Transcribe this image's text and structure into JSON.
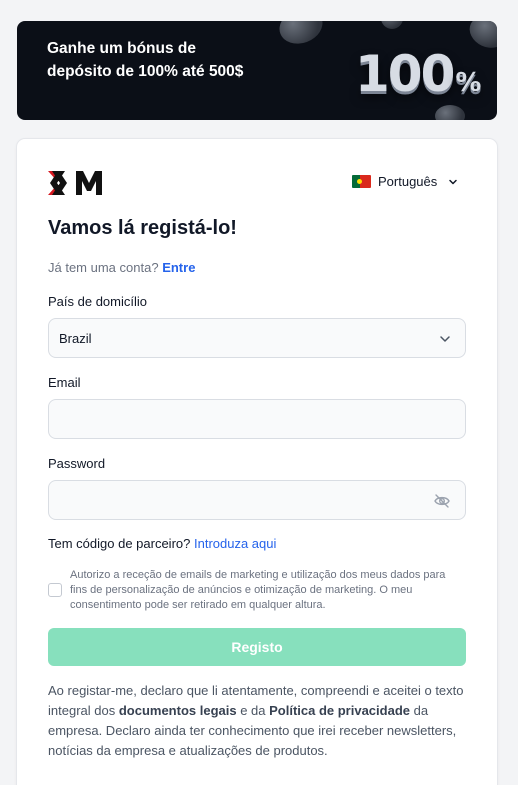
{
  "banner": {
    "text": "Ganhe um bónus de depósito de 100% até 500$",
    "graphic_number": "100",
    "graphic_percent": "%"
  },
  "header": {
    "logo_text": "XM",
    "language": "Português"
  },
  "form": {
    "title": "Vamos lá registá-lo!",
    "have_account_text": "Já tem uma conta?",
    "login_link": "Entre",
    "country_label": "País de domicílio",
    "country_value": "Brazil",
    "email_label": "Email",
    "email_value": "",
    "password_label": "Password",
    "password_value": "",
    "partner_text": "Tem código de parceiro?",
    "partner_link": "Introduza aqui",
    "consent_text": "Autorizo a receção de emails de marketing e utilização dos meus dados para fins de personalização de anúncios e otimização de marketing. O meu consentimento pode ser retirado em qualquer altura.",
    "consent_checked": false,
    "submit_label": "Registo"
  },
  "legal": {
    "part1": "Ao registar-me, declaro que li atentamente, compreendi e aceitei o texto integral dos ",
    "docs_link": "documentos legais",
    "part2": " e da ",
    "privacy_link": "Política de privacidade",
    "part3": " da empresa. Declaro ainda ter conhecimento que irei receber newsletters, notícias da empresa e atualizações de produtos."
  },
  "icons": {
    "language_flag": "portugal-flag-icon",
    "dropdown": "chevron-down-icon",
    "password_toggle": "eye-off-icon"
  },
  "colors": {
    "brand_red": "#d51820",
    "link_blue": "#2563eb",
    "button_green": "#87e0bd",
    "banner_bg": "#0b0f17"
  }
}
